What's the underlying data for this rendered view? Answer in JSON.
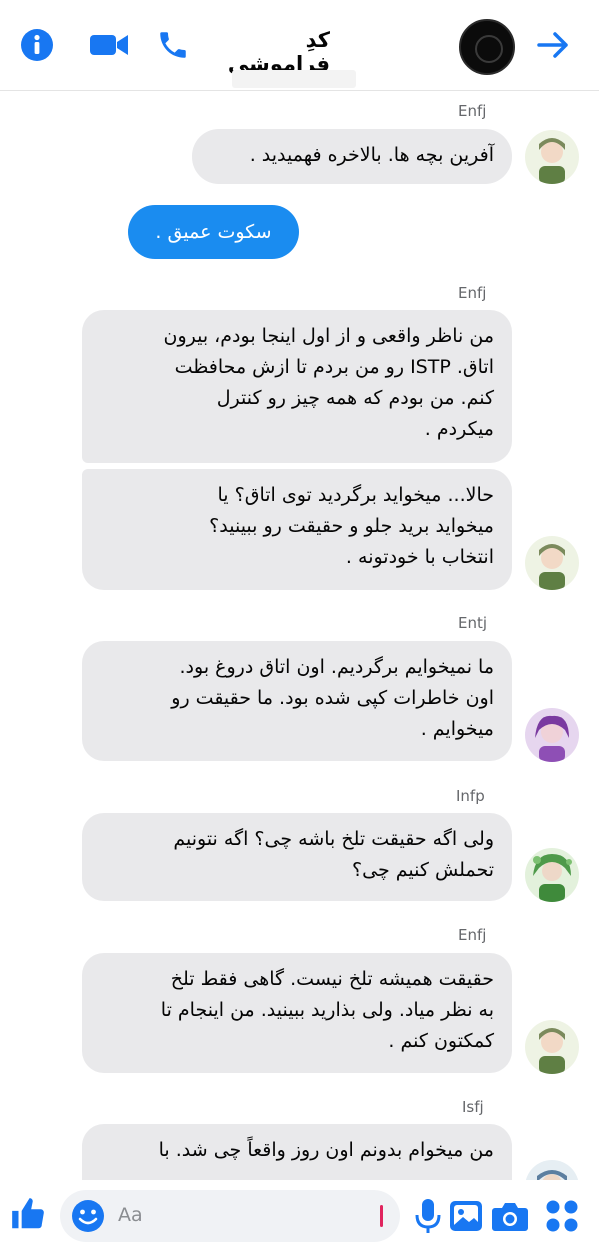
{
  "header": {
    "title": "کدِ فراموشی",
    "icons": [
      "info-icon",
      "video-call-icon",
      "phone-icon",
      "forward-arrow-icon"
    ],
    "accent": "#1877f2"
  },
  "messages": [
    {
      "sender": "Enfj",
      "lines": [
        "آفرین بچه ها. بالاخره فهمیدید ."
      ]
    },
    {
      "me": "سکوت عمیق ."
    },
    {
      "sender": "Enfj",
      "lines": [
        "من ناظر واقعی و از اول اینجا بودم، بیرون",
        "اتاق. ISTP رو من بردم تا ازش محافظت",
        "کنم. من بودم که همه چیز رو کنترل",
        "میکردم ."
      ]
    },
    {
      "lines": [
        "حالا... میخواید برگردید توی اتاق؟ یا",
        "میخواید برید جلو و حقیقت رو ببینید؟",
        "انتخاب با خودتونه ."
      ]
    },
    {
      "sender": "Entj",
      "lines": [
        "ما نمیخوایم برگردیم. اون اتاق دروغ بود.",
        "اون خاطرات کپی شده بود. ما حقیقت رو",
        "میخوایم ."
      ]
    },
    {
      "sender": "Infp",
      "lines": [
        "ولی اگه حقیقت تلخ باشه چی؟ اگه نتونیم",
        "تحملش کنیم چی؟"
      ]
    },
    {
      "sender": "Enfj",
      "lines": [
        "حقیقت همیشه تلخ نیست. گاهی فقط تلخ",
        "به نظر میاد. ولی بذارید ببینید. من اینجام تا",
        "کمکتون کنم ."
      ]
    },
    {
      "sender": "Isfj",
      "lines": [
        "من میخوام بدونم اون روز واقعاً چی شد. با"
      ]
    }
  ],
  "composer": {
    "placeholder": "Aa",
    "icons": [
      "like-icon",
      "emoji-icon",
      "microphone-icon",
      "gallery-icon",
      "camera-icon",
      "apps-icon"
    ]
  }
}
